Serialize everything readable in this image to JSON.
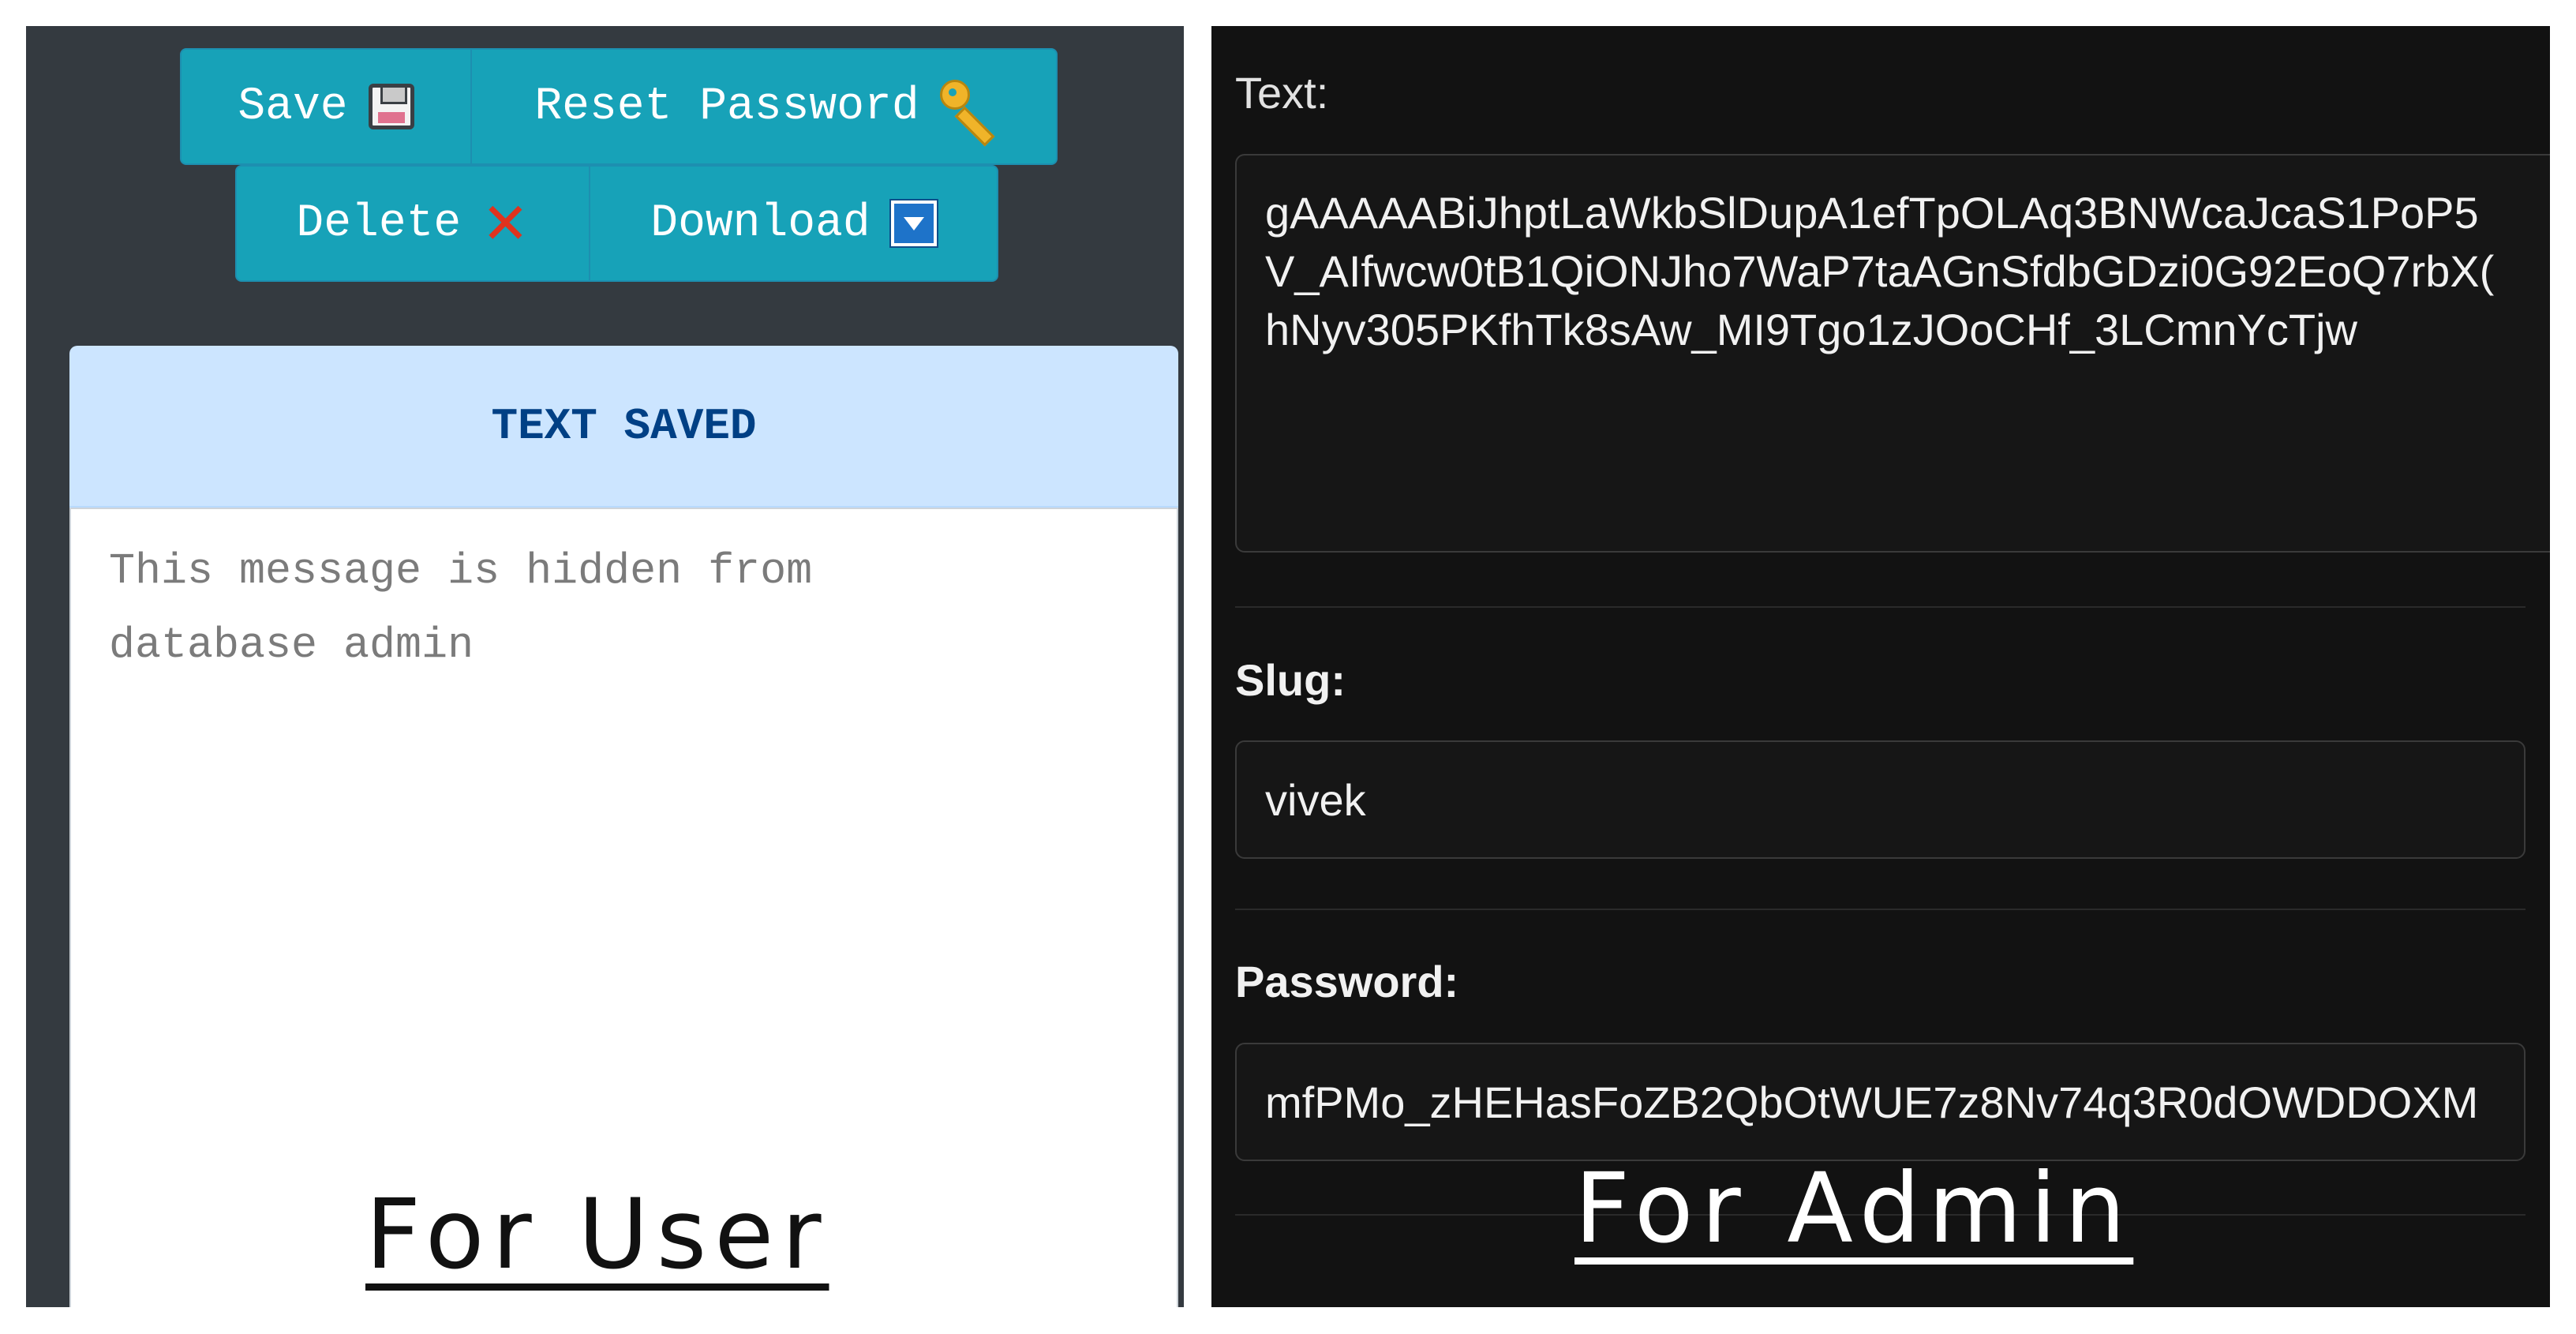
{
  "user_panel": {
    "buttons": {
      "save": {
        "label": "Save",
        "icon": "floppy-disk-icon"
      },
      "reset_password": {
        "label": "Reset Password",
        "icon": "key-icon"
      },
      "delete": {
        "label": "Delete",
        "icon": "red-x-icon"
      },
      "download": {
        "label": "Download",
        "icon": "download-box-icon"
      }
    },
    "alert": "TEXT SAVED",
    "message_lines": [
      "This message is hidden from",
      "database admin"
    ],
    "caption": "For User"
  },
  "admin_panel": {
    "text_label": "Text:",
    "text_lines": [
      "gAAAAABiJhptLaWkbSlDupA1efTpOLAq3BNWcaJcaS1PoP5",
      "V_AIfwcw0tB1QiONJho7WaP7taAGnSfdbGDzi0G92EoQ7rbX(",
      "hNyv305PKfhTk8sAw_MI9Tgo1zJOoCHf_3LCmnYcTjw"
    ],
    "slug_label": "Slug:",
    "slug_value": "vivek",
    "password_label": "Password:",
    "password_value": "mfPMo_zHEHasFoZB2QbOtWUE7z8Nv74q3R0dOWDDOXM",
    "caption": "For Admin"
  },
  "colors": {
    "button_bg": "#17a2b8",
    "alert_bg": "#cce5ff",
    "alert_text": "#004085",
    "user_panel_bg": "#343a40",
    "admin_panel_bg": "#121212"
  }
}
